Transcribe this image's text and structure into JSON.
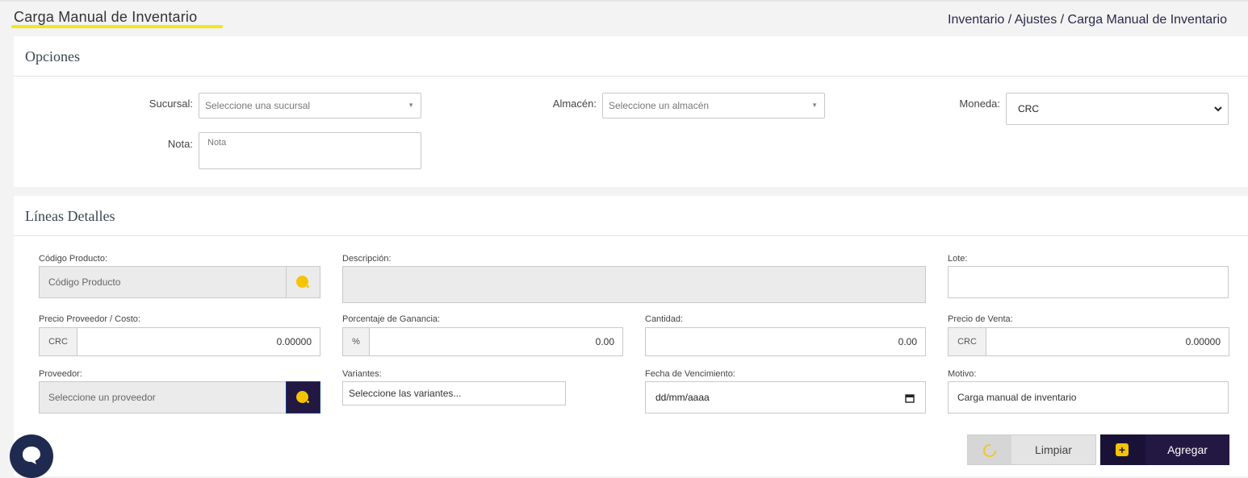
{
  "header": {
    "title": "Carga Manual de Inventario",
    "breadcrumb": "Inventario / Ajustes / Carga Manual de Inventario"
  },
  "opciones": {
    "title": "Opciones",
    "sucursal": {
      "label": "Sucursal:",
      "placeholder": "Seleccione una sucursal"
    },
    "almacen": {
      "label": "Almacén:",
      "placeholder": "Seleccione un almacén"
    },
    "moneda": {
      "label": "Moneda:",
      "value": "CRC"
    },
    "nota": {
      "label": "Nota:",
      "placeholder": "Nota"
    }
  },
  "lineas": {
    "title": "Líneas Detalles",
    "codigo": {
      "label": "Código Producto:",
      "placeholder": "Código Producto"
    },
    "descripcion": {
      "label": "Descripción:"
    },
    "lote": {
      "label": "Lote:"
    },
    "precio_proveedor": {
      "label": "Precio Proveedor / Costo:",
      "addon": "CRC",
      "value": "0.00000"
    },
    "porcentaje": {
      "label": "Porcentaje de Ganancia:",
      "addon": "%",
      "value": "0.00"
    },
    "cantidad": {
      "label": "Cantidad:",
      "value": "0.00"
    },
    "precio_venta": {
      "label": "Precio de Venta:",
      "addon": "CRC",
      "value": "0.00000"
    },
    "proveedor": {
      "label": "Proveedor:",
      "placeholder": "Seleccione un proveedor"
    },
    "variantes": {
      "label": "Variantes:",
      "placeholder": "Seleccione las variantes..."
    },
    "fecha": {
      "label": "Fecha de Vencimiento:",
      "placeholder": "dd/mm/aaaa"
    },
    "motivo": {
      "label": "Motivo:",
      "value": "Carga manual de inventario"
    }
  },
  "actions": {
    "limpiar": "Limpiar",
    "agregar": "Agregar"
  },
  "colors": {
    "accent": "#f5c400",
    "primary_dark": "#221842",
    "title_underline": "#f4e61d"
  },
  "icons": {
    "search": "search-icon",
    "refresh": "refresh-icon",
    "plus": "plus-icon",
    "calendar": "calendar-icon",
    "chat": "chat-icon"
  }
}
